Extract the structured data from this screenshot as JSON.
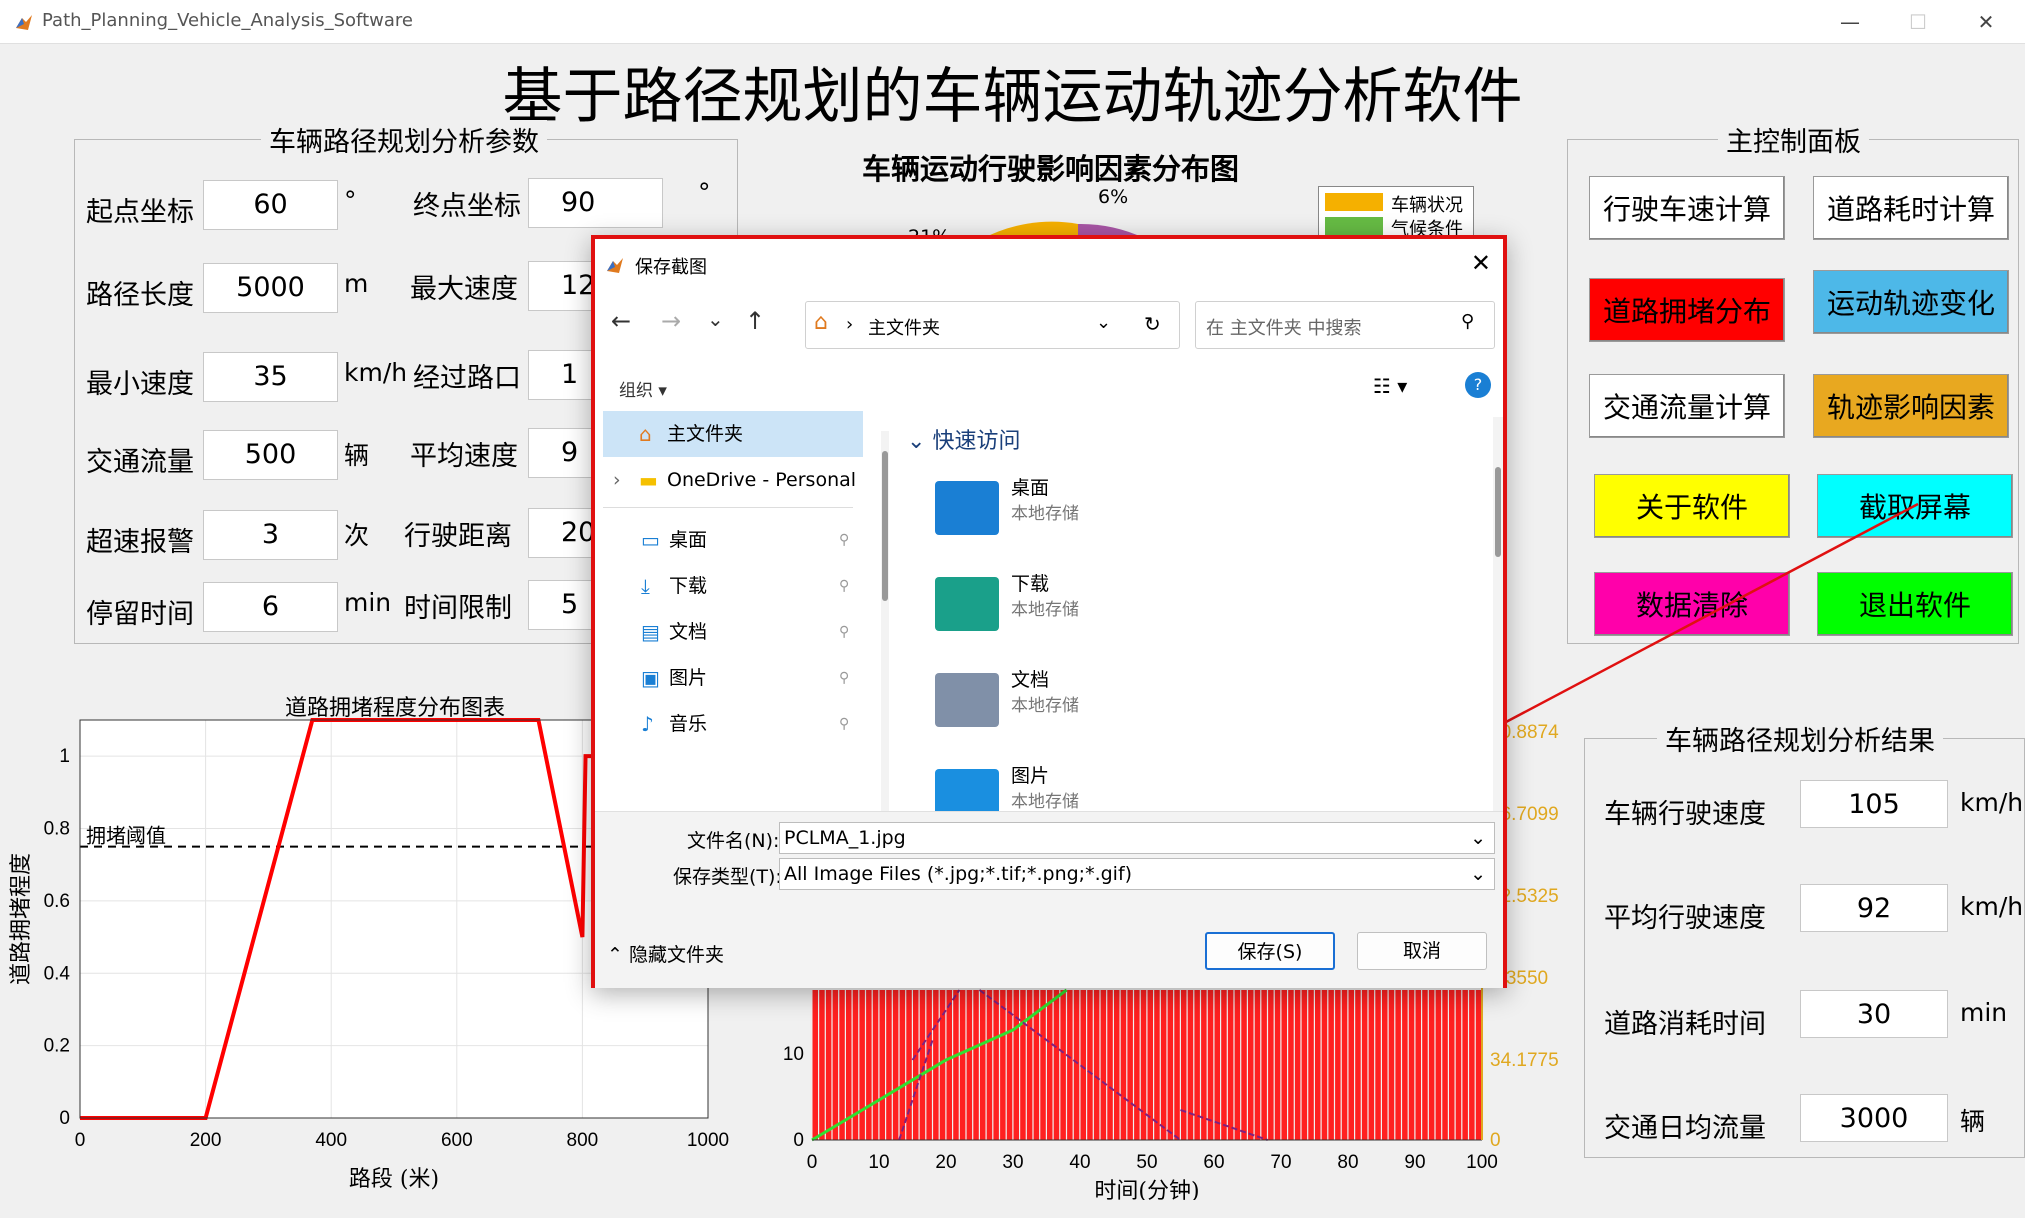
{
  "window": {
    "title": "Path_Planning_Vehicle_Analysis_Software"
  },
  "main_title": "基于路径规划的车辆运动轨迹分析软件",
  "params_panel": {
    "title": "车辆路径规划分析参数",
    "rows": [
      {
        "label1": "起点坐标",
        "value1": "60",
        "unit1": "°",
        "label2": "终点坐标",
        "value2": "90",
        "unit2": "°"
      },
      {
        "label1": "路径长度",
        "value1": "5000",
        "unit1": "m",
        "label2": "最大速度",
        "value2": "12"
      },
      {
        "label1": "最小速度",
        "value1": "35",
        "unit1": "km/h",
        "label2": "经过路口",
        "value2": "1"
      },
      {
        "label1": "交通流量",
        "value1": "500",
        "unit1": "辆",
        "label2": "平均速度",
        "value2": "9"
      },
      {
        "label1": "超速报警",
        "value1": "3",
        "unit1": "次",
        "label2": "行驶距离",
        "value2": "20"
      },
      {
        "label1": "停留时间",
        "value1": "6",
        "unit1": "min",
        "label2": "时间限制",
        "value2": "5"
      }
    ]
  },
  "control_panel": {
    "title": "主控制面板",
    "buttons": [
      {
        "label": "行驶车速计算",
        "bg": "#ffffff"
      },
      {
        "label": "道路耗时计算",
        "bg": "#ffffff"
      },
      {
        "label": "道路拥堵分布",
        "bg": "#ff0000"
      },
      {
        "label": "运动轨迹变化",
        "bg": "#4db8e8"
      },
      {
        "label": "交通流量计算",
        "bg": "#ffffff"
      },
      {
        "label": "轨迹影响因素",
        "bg": "#e8a820"
      },
      {
        "label": "关于软件",
        "bg": "#ffff00"
      },
      {
        "label": "截取屏幕",
        "bg": "#00ffff"
      },
      {
        "label": "数据清除",
        "bg": "#ff00aa"
      },
      {
        "label": "退出软件",
        "bg": "#00ff00"
      }
    ]
  },
  "results_panel": {
    "title": "车辆路径规划分析结果",
    "rows": [
      {
        "label": "车辆行驶速度",
        "value": "105",
        "unit": "km/h"
      },
      {
        "label": "平均行驶速度",
        "value": "92",
        "unit": "km/h"
      },
      {
        "label": "道路消耗时间",
        "value": "30",
        "unit": "min"
      },
      {
        "label": "交通日均流量",
        "value": "3000",
        "unit": "辆"
      }
    ]
  },
  "pie_chart": {
    "title": "车辆运动行驶影响因素分布图",
    "labels_visible": [
      "6%",
      "21%"
    ],
    "legend": [
      {
        "name": "车辆状况",
        "color": "#f5b000"
      },
      {
        "name": "气候条件",
        "color": "#66bb44"
      }
    ]
  },
  "chart_data": [
    {
      "type": "line",
      "title": "道路拥堵程度分布图表",
      "xlabel": "路段 (米)",
      "ylabel": "道路拥堵程度",
      "xlim": [
        0,
        1000
      ],
      "ylim": [
        0,
        1.1
      ],
      "x_ticks": [
        "0",
        "200",
        "400",
        "600",
        "800",
        "1000"
      ],
      "y_ticks": [
        "0",
        "0.2",
        "0.4",
        "0.6",
        "0.8",
        "1"
      ],
      "threshold": {
        "label": "拥堵阈值",
        "value": 0.75
      },
      "series": [
        {
          "color": "#ff0000",
          "x": [
            0,
            200,
            370,
            730,
            800,
            805,
            1000
          ],
          "y": [
            0,
            0,
            1.1,
            1.1,
            0.5,
            1.0,
            1.0
          ]
        }
      ],
      "grid": true
    },
    {
      "type": "bar",
      "xlabel": "时间(分钟)",
      "xlim": [
        0,
        100
      ],
      "x_ticks": [
        "0",
        "10",
        "20",
        "30",
        "40",
        "50",
        "60",
        "70",
        "80",
        "90",
        "100"
      ],
      "y_ticks_left": [
        "0",
        "10"
      ],
      "y_ticks_right": [
        "0",
        "34.1775",
        "3.3550",
        "02.5325",
        "36.7099",
        "70.8874"
      ],
      "bar_color": "#ff2020"
    }
  ],
  "dialog": {
    "title": "保存截图",
    "nav": {
      "path": "主文件夹",
      "search_placeholder": "在 主文件夹 中搜索"
    },
    "toolbar": {
      "organize": "组织"
    },
    "sidebar": [
      {
        "label": "主文件夹",
        "icon": "home-icon",
        "selected": true
      },
      {
        "label": "OneDrive - Personal",
        "icon": "folder-icon"
      },
      {
        "label": "桌面",
        "icon": "desktop-icon"
      },
      {
        "label": "下载",
        "icon": "download-icon"
      },
      {
        "label": "文档",
        "icon": "document-icon"
      },
      {
        "label": "图片",
        "icon": "picture-icon"
      },
      {
        "label": "音乐",
        "icon": "music-icon"
      }
    ],
    "quick_access_title": "快速访问",
    "folders": [
      {
        "name": "桌面",
        "sub": "本地存储",
        "color": "#1a7fd4"
      },
      {
        "name": "下载",
        "sub": "本地存储",
        "color": "#1aa08a"
      },
      {
        "name": "文档",
        "sub": "本地存储",
        "color": "#8090a8"
      },
      {
        "name": "图片",
        "sub": "本地存储",
        "color": "#1a8fe0"
      }
    ],
    "filename_label": "文件名(N):",
    "filename_value": "PCLMA_1.jpg",
    "filetype_label": "保存类型(T):",
    "filetype_value": "All Image Files (*.jpg;*.tif;*.png;*.gif)",
    "hide_folders": "隐藏文件夹",
    "save_button": "保存(S)",
    "cancel_button": "取消"
  }
}
